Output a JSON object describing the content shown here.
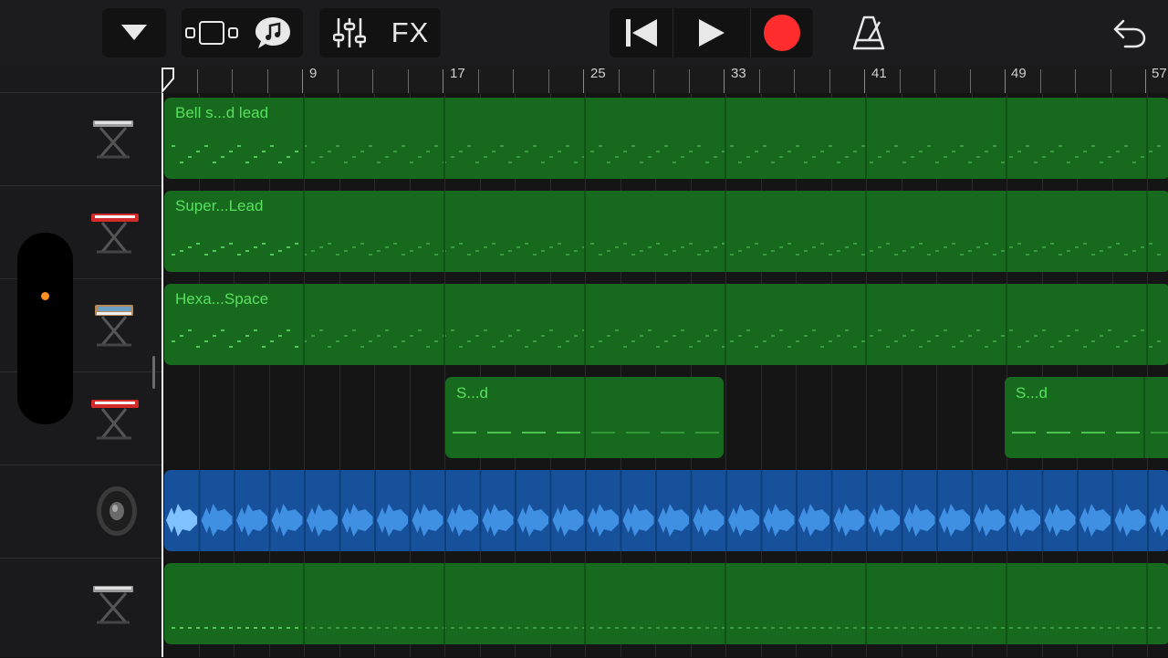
{
  "toolbar": {
    "tracks_menu": "triangle-down-icon",
    "view_toggle": "track-view-icon",
    "smart_controls": "music-chat-icon",
    "mixer": "mixer-sliders-icon",
    "fx_label": "FX",
    "rewind": "skip-back-icon",
    "play": "play-icon",
    "record": "record-icon",
    "metronome": "metronome-icon",
    "undo": "undo-icon",
    "record_color": "#ff2d2d"
  },
  "ruler": {
    "bar_labels": [
      "9",
      "17",
      "25",
      "33",
      "41",
      "49",
      "57"
    ]
  },
  "tracks": [
    {
      "instrument": "keyboard-stand-gray-icon",
      "regions": [
        {
          "name": "Bell s...d lead"
        }
      ]
    },
    {
      "instrument": "keyboard-stand-red-icon",
      "regions": [
        {
          "name": "Super...Lead"
        }
      ]
    },
    {
      "instrument": "keyboard-stand-synth-icon",
      "regions": [
        {
          "name": "Hexa...Space"
        }
      ]
    },
    {
      "instrument": "keyboard-stand-red-icon",
      "regions": [
        {
          "name": "S...d"
        },
        {
          "name": "S...d"
        }
      ]
    },
    {
      "instrument": "speaker-icon",
      "regions": [
        {
          "name": ""
        }
      ]
    },
    {
      "instrument": "keyboard-stand-gray-icon",
      "regions": [
        {
          "name": ""
        }
      ]
    }
  ],
  "colors": {
    "midi_region": "#17691e",
    "midi_text": "#59e060",
    "audio_region": "#17519c",
    "audio_wave": "#4c9be8",
    "volume_dot": "#ff8f1f"
  }
}
